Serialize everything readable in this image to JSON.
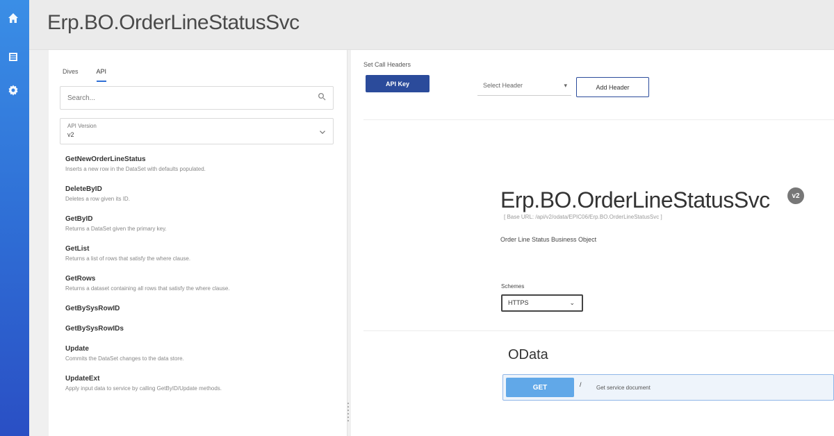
{
  "header": {
    "title": "Erp.BO.OrderLineStatusSvc"
  },
  "nav": {
    "icons": [
      "home-icon",
      "list-icon",
      "settings-icon"
    ]
  },
  "left_panel": {
    "tabs": [
      {
        "label": "Dives"
      },
      {
        "label": "API"
      }
    ],
    "search": {
      "placeholder": "Search..."
    },
    "filter": {
      "label": "API Version",
      "value": "v2"
    },
    "operations": [
      {
        "name": "GetNewOrderLineStatus",
        "desc": "Inserts a new row in the DataSet with defaults populated."
      },
      {
        "name": "DeleteByID",
        "desc": "Deletes a row given its ID."
      },
      {
        "name": "GetByID",
        "desc": "Returns a DataSet given the primary key."
      },
      {
        "name": "GetList",
        "desc": "Returns a list of rows that satisfy the where clause."
      },
      {
        "name": "GetRows",
        "desc": "Returns a dataset containing all rows that satisfy the where clause."
      },
      {
        "name": "GetBySysRowID",
        "desc": ""
      },
      {
        "name": "GetBySysRowIDs",
        "desc": ""
      },
      {
        "name": "Update",
        "desc": "Commits the DataSet changes to the data store."
      },
      {
        "name": "UpdateExt",
        "desc": "Apply input data to service by calling GetByID/Update methods."
      }
    ]
  },
  "right_panel": {
    "headers_label": "Set Call Headers",
    "api_key_button": "API Key",
    "header_select": {
      "placeholder": "Select Header"
    },
    "add_header_button": "Add Header",
    "service": {
      "title": "Erp.BO.OrderLineStatusSvc",
      "version_badge": "v2",
      "base_url": "[ Base URL: /api/v2/odata/EPIC06/Erp.BO.OrderLineStatusSvc ]",
      "description": "Order Line Status Business Object"
    },
    "schemes": {
      "label": "Schemes",
      "value": "HTTPS"
    },
    "section_title": "OData",
    "first_operation": {
      "method": "GET",
      "path": "/",
      "summary": "Get service document"
    }
  },
  "colors": {
    "rail_top": "#3a8ee6",
    "rail_bottom": "#2a4fc4",
    "primary_button": "#2b4b9b",
    "get_method": "#61a8e8"
  }
}
